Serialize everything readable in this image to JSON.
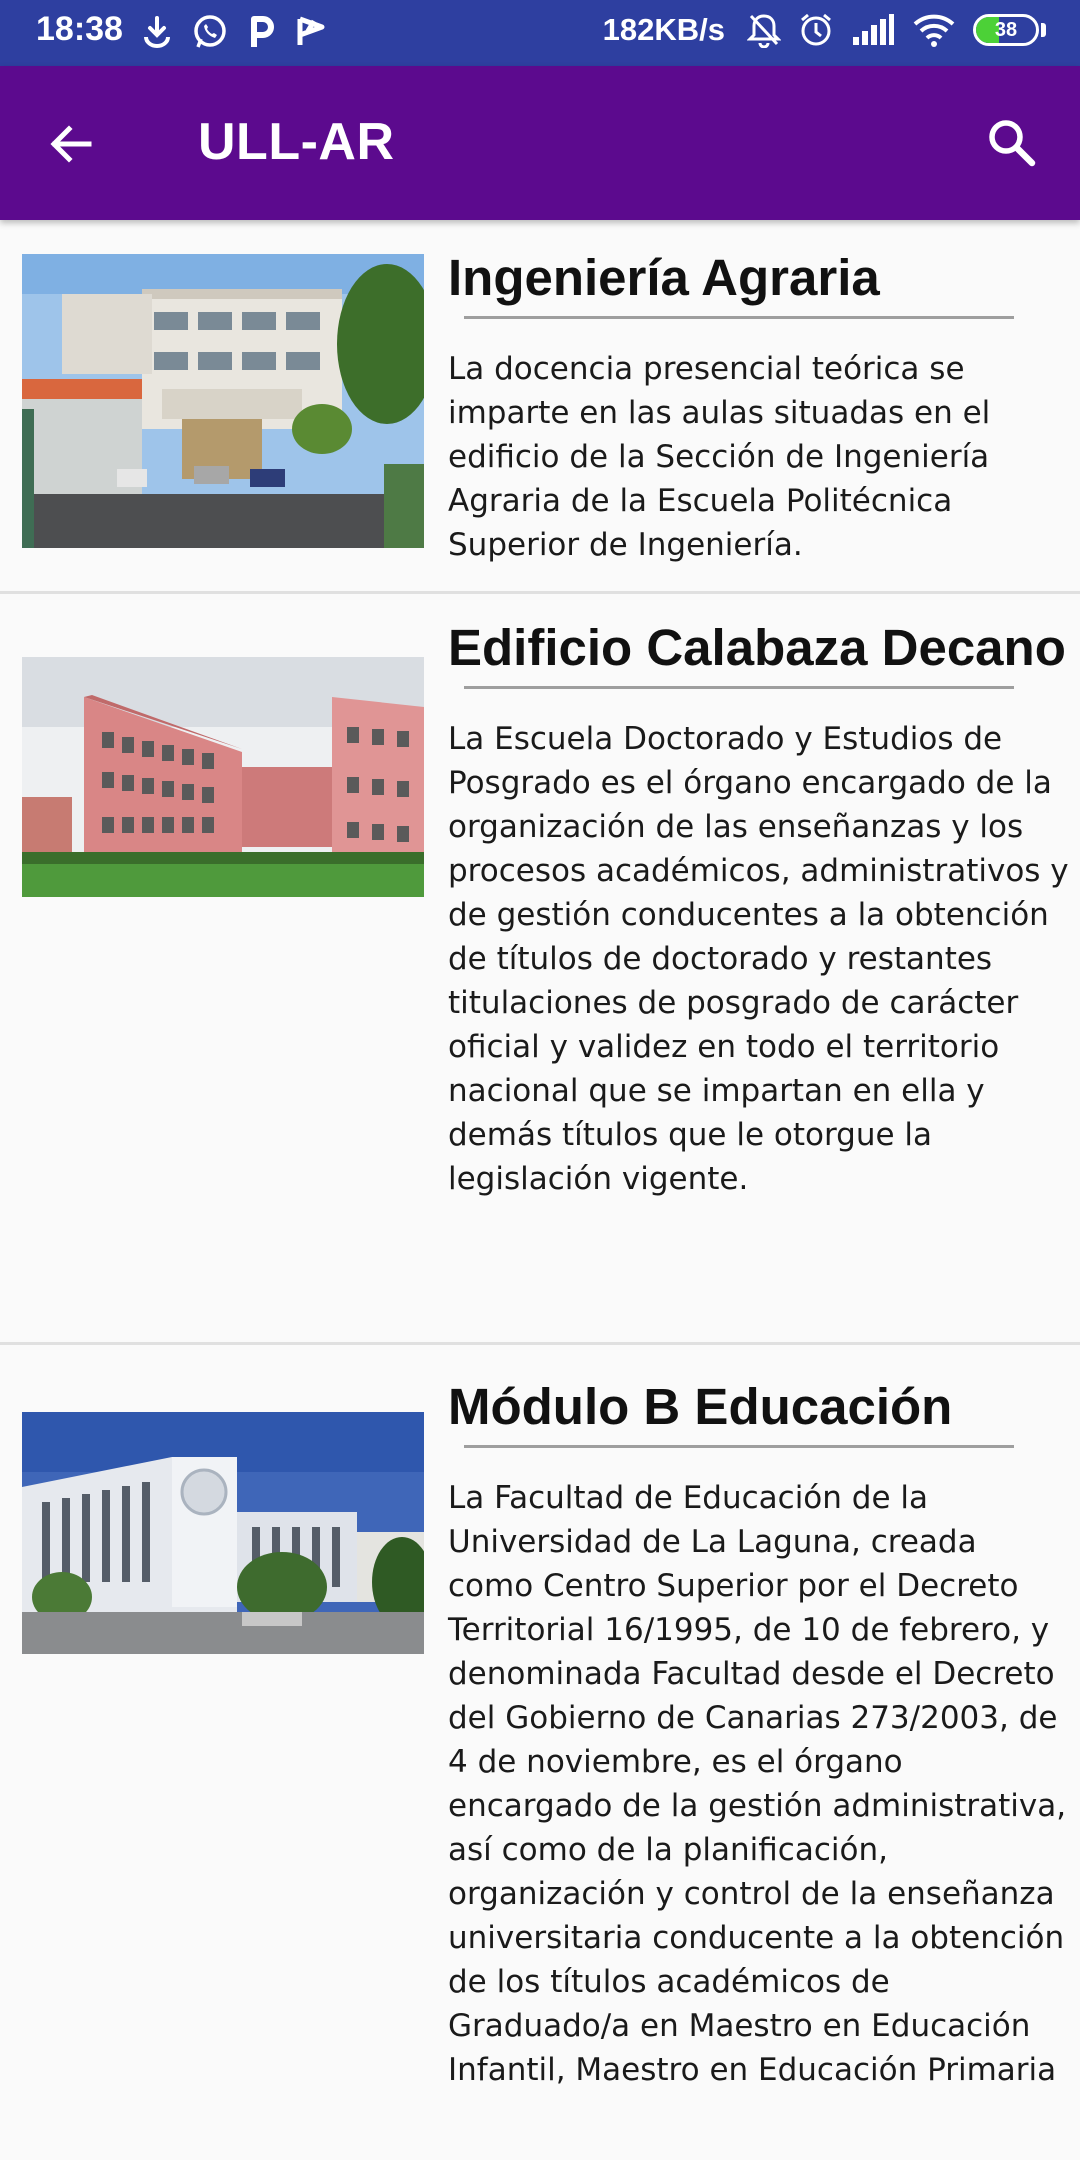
{
  "status_bar": {
    "time": "18:38",
    "notifications": [
      "download-icon",
      "whatsapp-icon",
      "parking-icon",
      "flag-icon"
    ],
    "speed": "182KB/s",
    "battery_level": "38",
    "battery_fraction": 0.38,
    "right_icons": [
      "mute-icon",
      "alarm-icon",
      "signal-icon",
      "wifi-icon"
    ]
  },
  "app_bar": {
    "title": "ULL-AR",
    "background": "#5c0a8e"
  },
  "items": [
    {
      "title": "Ingeniería Agraria",
      "description": "La docencia presencial teórica se imparte en las aulas situadas en el edificio de la Sección de Ingeniería Agraria de la Escuela Politécnica Superior de Ingeniería."
    },
    {
      "title": "Edificio Calabaza Decano",
      "description": "La Escuela Doctorado y Estudios de Posgrado es el órgano encargado de la organización de las enseñanzas y los procesos académicos, administrativos y de gestión conducentes a la obtención de títulos de doctorado y restantes titulaciones de posgrado de carácter oficial y validez en todo el territorio nacional que se impartan en ella y demás títulos que le otorgue la legislación vigente."
    },
    {
      "title": "Módulo B Educación",
      "description": "La Facultad de Educación de la Universidad de La Laguna, creada como Centro Superior por el Decreto Territorial 16/1995, de 10 de febrero, y denominada Facultad desde el Decreto del Gobierno de Canarias 273/2003, de 4 de noviembre, es el órgano encargado de la gestión administrativa, así como de la planificación, organización y control de la enseñanza universitaria conducente a la obtención de los títulos académicos de Graduado/a en Maestro en Educación Infantil, Maestro en Educación Primaria"
    }
  ]
}
